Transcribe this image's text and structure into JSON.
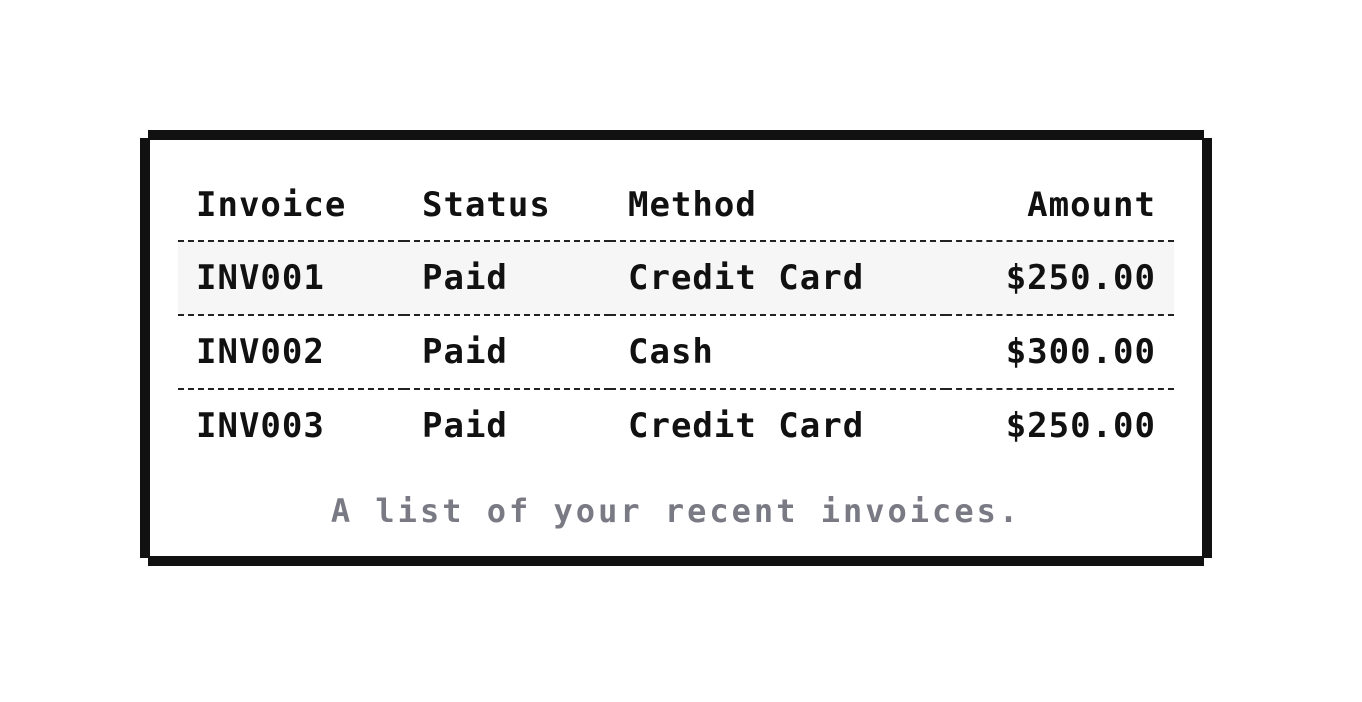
{
  "table": {
    "headers": {
      "invoice": "Invoice",
      "status": "Status",
      "method": "Method",
      "amount": "Amount"
    },
    "rows": [
      {
        "invoice": "INV001",
        "status": "Paid",
        "method": "Credit Card",
        "amount": "$250.00"
      },
      {
        "invoice": "INV002",
        "status": "Paid",
        "method": "Cash",
        "amount": "$300.00"
      },
      {
        "invoice": "INV003",
        "status": "Paid",
        "method": "Credit Card",
        "amount": "$250.00"
      }
    ],
    "caption": "A list of your recent invoices."
  },
  "colors": {
    "border": "#111111",
    "text": "#111111",
    "caption": "#7a7a85",
    "row_highlight": "#f6f6f6"
  }
}
